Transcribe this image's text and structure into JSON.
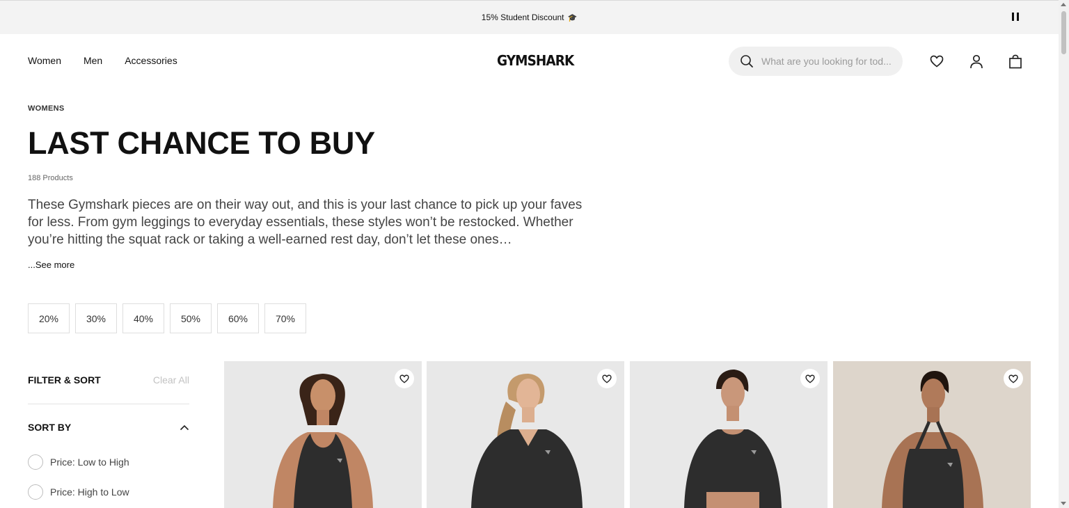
{
  "announcement": {
    "text": "15% Student Discount",
    "icon": "graduation-cap-icon",
    "pause_icon": "pause-icon"
  },
  "nav": {
    "links": [
      "Women",
      "Men",
      "Accessories"
    ],
    "logo": "GYMSHARK",
    "search": {
      "placeholder": "What are you looking for tod...",
      "icon": "search-icon"
    },
    "icons": [
      "heart-icon",
      "user-icon",
      "bag-icon"
    ]
  },
  "page": {
    "breadcrumb": "WOMENS",
    "title": "LAST CHANCE TO BUY",
    "product_count": "188 Products",
    "description": "These Gymshark pieces are on their way out, and this is your last chance to pick up your faves for less. From gym leggings to everyday essentials, these styles won’t be restocked. Whether you’re hitting the squat rack or taking a well-earned rest day, don’t let these ones…",
    "see_more": "...See more"
  },
  "discount_chips": [
    "20%",
    "30%",
    "40%",
    "50%",
    "60%",
    "70%"
  ],
  "filter": {
    "title": "FILTER & SORT",
    "clear_all": "Clear All",
    "sort_by": "SORT BY",
    "sort_options": [
      "Price: Low to High",
      "Price: High to Low"
    ]
  },
  "colors": {
    "announcement_bg": "#f3f3f3",
    "search_bg": "#f0f0f0",
    "product_bg": "#e8e8e8",
    "product_bg_warm": "#ddd5cb",
    "garment": "#2d2d2d"
  }
}
